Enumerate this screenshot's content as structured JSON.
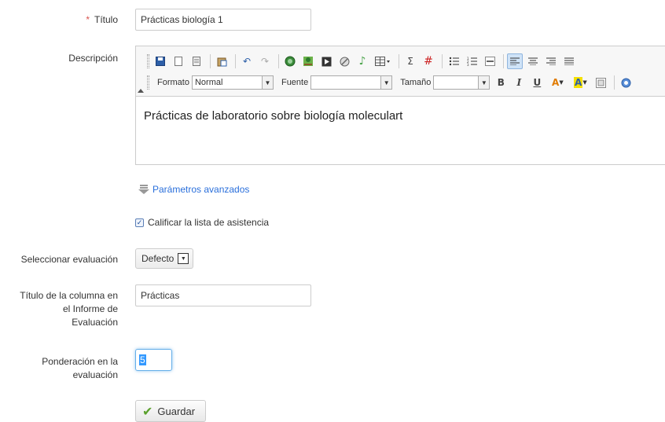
{
  "titulo": {
    "required_mark": "*",
    "label": "Título",
    "value": "Prácticas biología 1"
  },
  "descripcion": {
    "label": "Descripción",
    "content": "Prácticas de laboratorio sobre biología moleculart",
    "toolbar": {
      "formato_label": "Formato",
      "formato_value": "Normal",
      "fuente_label": "Fuente",
      "fuente_value": "",
      "tamano_label": "Tamaño",
      "tamano_value": "",
      "bold": "B",
      "italic": "I",
      "underline": "U",
      "sigma": "Σ"
    }
  },
  "advanced": {
    "label": "Parámetros avanzados"
  },
  "attendance": {
    "checked": true,
    "label": "Calificar la lista de asistencia"
  },
  "evaluacion": {
    "label": "Seleccionar evaluación",
    "selected": "Defecto"
  },
  "column_title": {
    "label_line1": "Título de la columna en",
    "label_line2": "el Informe de",
    "label_line3": "Evaluación",
    "value": "Prácticas"
  },
  "ponderacion": {
    "label_line1": "Ponderación en la",
    "label_line2": "evaluación",
    "value": "5"
  },
  "save": {
    "label": "Guardar"
  },
  "colors": {
    "required": "#d9534f",
    "link": "#2a6fdb",
    "focus": "#66afe9",
    "save_check": "#5aa02c"
  }
}
